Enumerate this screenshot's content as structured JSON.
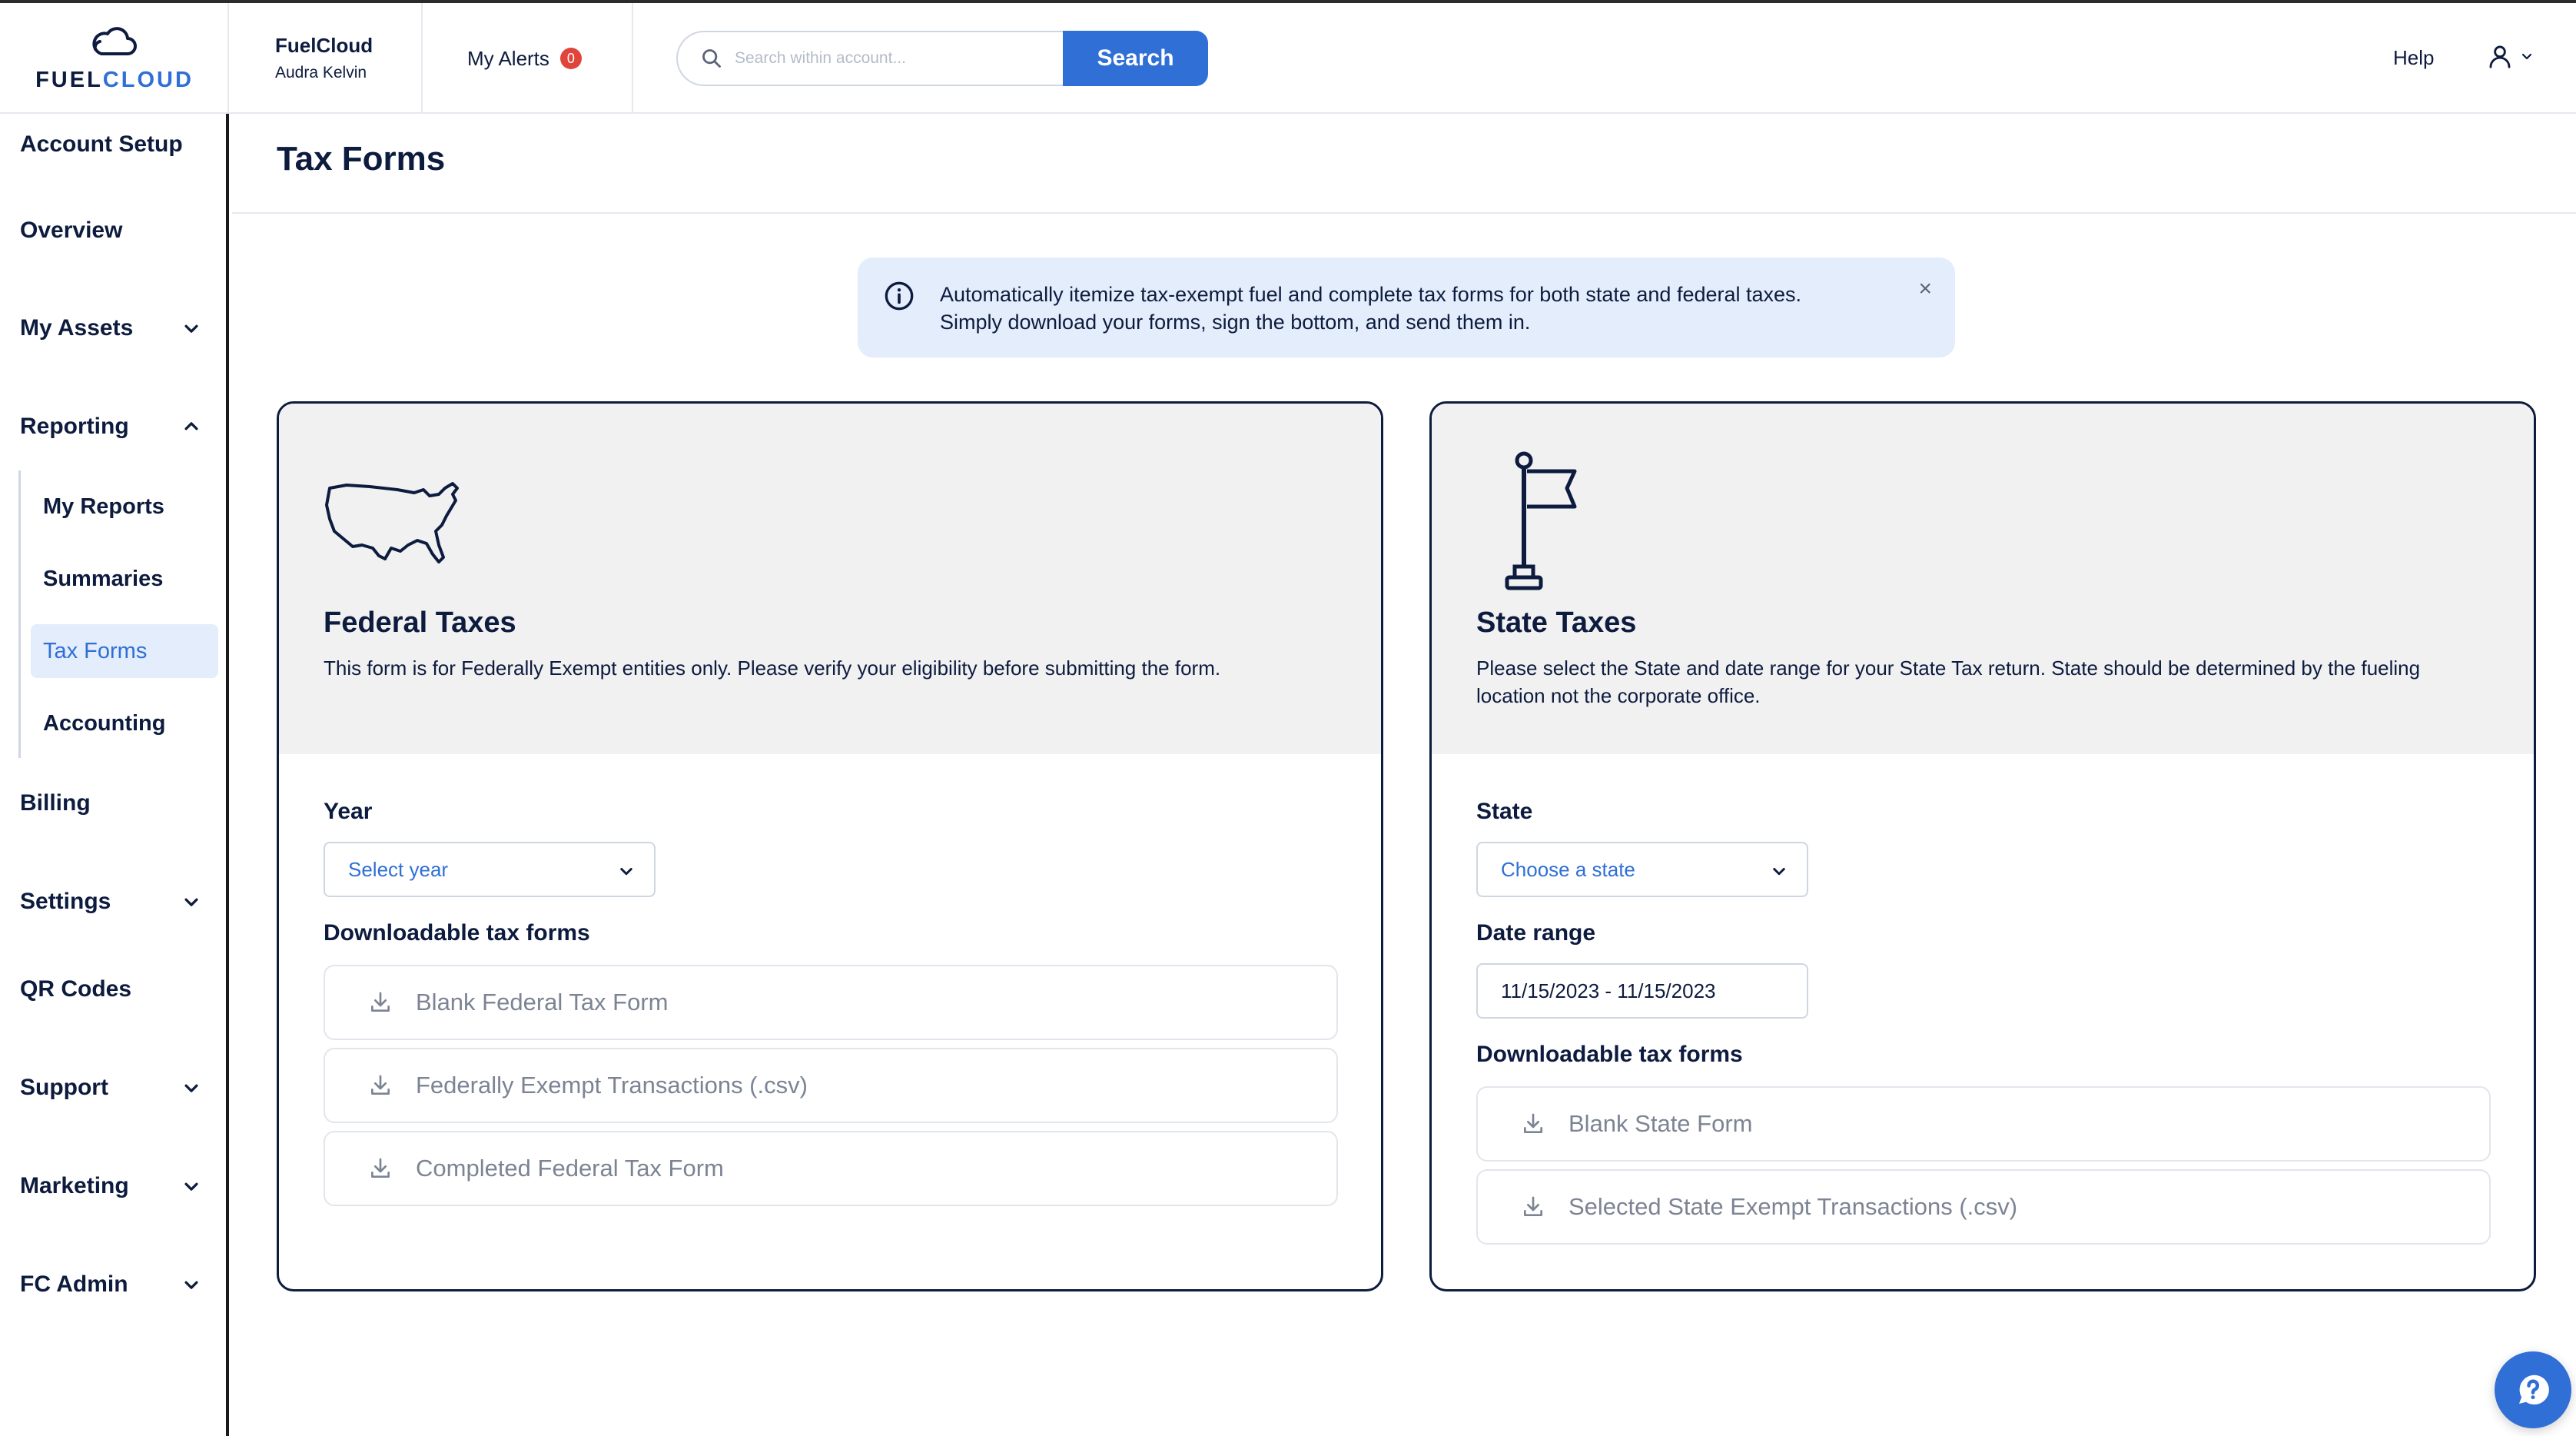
{
  "header": {
    "logo": {
      "fuel": "FUEL",
      "cloud": "CLOUD"
    },
    "account_name": "FuelCloud",
    "account_user": "Audra Kelvin",
    "alerts_label": "My Alerts",
    "alerts_count": "0",
    "search_placeholder": "Search within account...",
    "search_button": "Search",
    "help_label": "Help"
  },
  "sidebar": {
    "items": [
      {
        "label": "Account Setup"
      },
      {
        "label": "Overview"
      },
      {
        "label": "My Assets"
      },
      {
        "label": "Reporting"
      },
      {
        "label": "Billing"
      },
      {
        "label": "Settings"
      },
      {
        "label": "QR Codes"
      },
      {
        "label": "Support"
      },
      {
        "label": "Marketing"
      },
      {
        "label": "FC Admin"
      }
    ],
    "reporting_sub": [
      {
        "label": "My Reports"
      },
      {
        "label": "Summaries"
      },
      {
        "label": "Tax Forms"
      },
      {
        "label": "Accounting"
      }
    ]
  },
  "main": {
    "page_title": "Tax Forms",
    "banner": {
      "line1": "Automatically itemize tax-exempt fuel and complete tax forms for both state and federal taxes.",
      "line2": "Simply download your forms, sign the bottom, and send them in.",
      "close": "×"
    },
    "federal": {
      "title": "Federal Taxes",
      "description": "This form is for Federally Exempt entities only. Please verify your eligibility before submitting the form.",
      "year_label": "Year",
      "year_value": "Select year",
      "forms_label": "Downloadable tax forms",
      "forms": [
        {
          "label": "Blank Federal Tax Form"
        },
        {
          "label": "Federally Exempt Transactions (.csv)"
        },
        {
          "label": "Completed Federal Tax Form"
        }
      ]
    },
    "state": {
      "title": "State Taxes",
      "description": "Please select the State and date range for your State Tax return. State should be determined by the fueling location not the corporate office.",
      "state_label": "State",
      "state_value": "Choose a state",
      "date_label": "Date range",
      "date_value": "11/15/2023 - 11/15/2023",
      "forms_label": "Downloadable tax forms",
      "forms": [
        {
          "label": "Blank State Form"
        },
        {
          "label": "Selected State Exempt Transactions (.csv)"
        }
      ]
    }
  },
  "colors": {
    "navy": "#0d1b3e",
    "accent": "#2f6fd6",
    "banner_bg": "#e3edfb",
    "badge": "#e0443a"
  },
  "icons": [
    "cloud-logo-icon",
    "search-icon",
    "user-icon",
    "chevron-down-icon",
    "chevron-up-icon",
    "info-icon",
    "close-icon",
    "usa-map-icon",
    "flag-icon",
    "download-icon",
    "help-chat-icon"
  ]
}
